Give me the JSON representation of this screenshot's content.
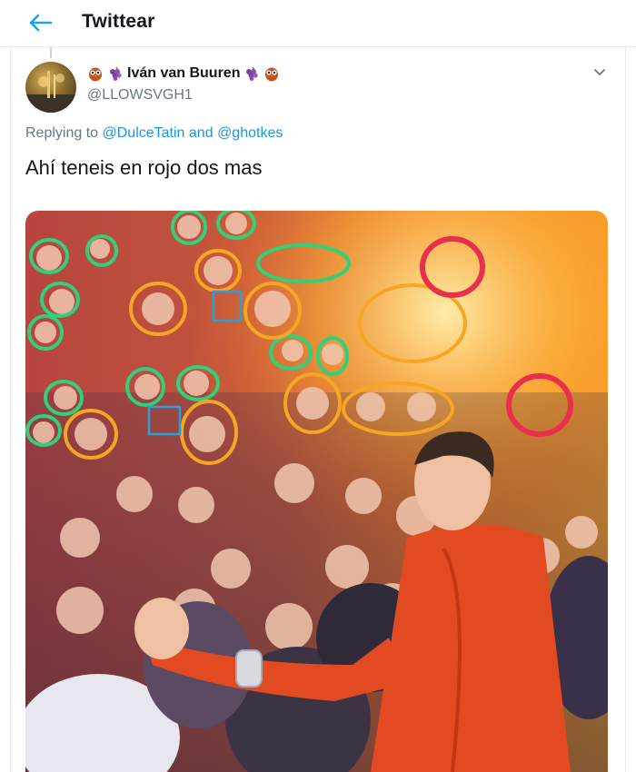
{
  "header": {
    "title": "Twittear"
  },
  "tweet": {
    "display_name": "Iván van Buuren",
    "handle": "@LLOWSVGH1",
    "replying_prefix": "Replying to",
    "reply_user_1": "@DulceTatin",
    "reply_joiner": "and",
    "reply_user_2": "@ghotkes",
    "text": "Ahí teneis en rojo dos mas"
  },
  "colors": {
    "accent": "#1b95e0",
    "circle_green": "#2fd17a",
    "circle_orange": "#f5a623",
    "circle_red": "#e8304e",
    "box_blue": "#2a9fd8"
  },
  "icons": {
    "back": "back-arrow-icon",
    "caret": "chevron-down-icon",
    "owl": "owl-emoji-icon",
    "grapes": "grapes-emoji-icon"
  }
}
